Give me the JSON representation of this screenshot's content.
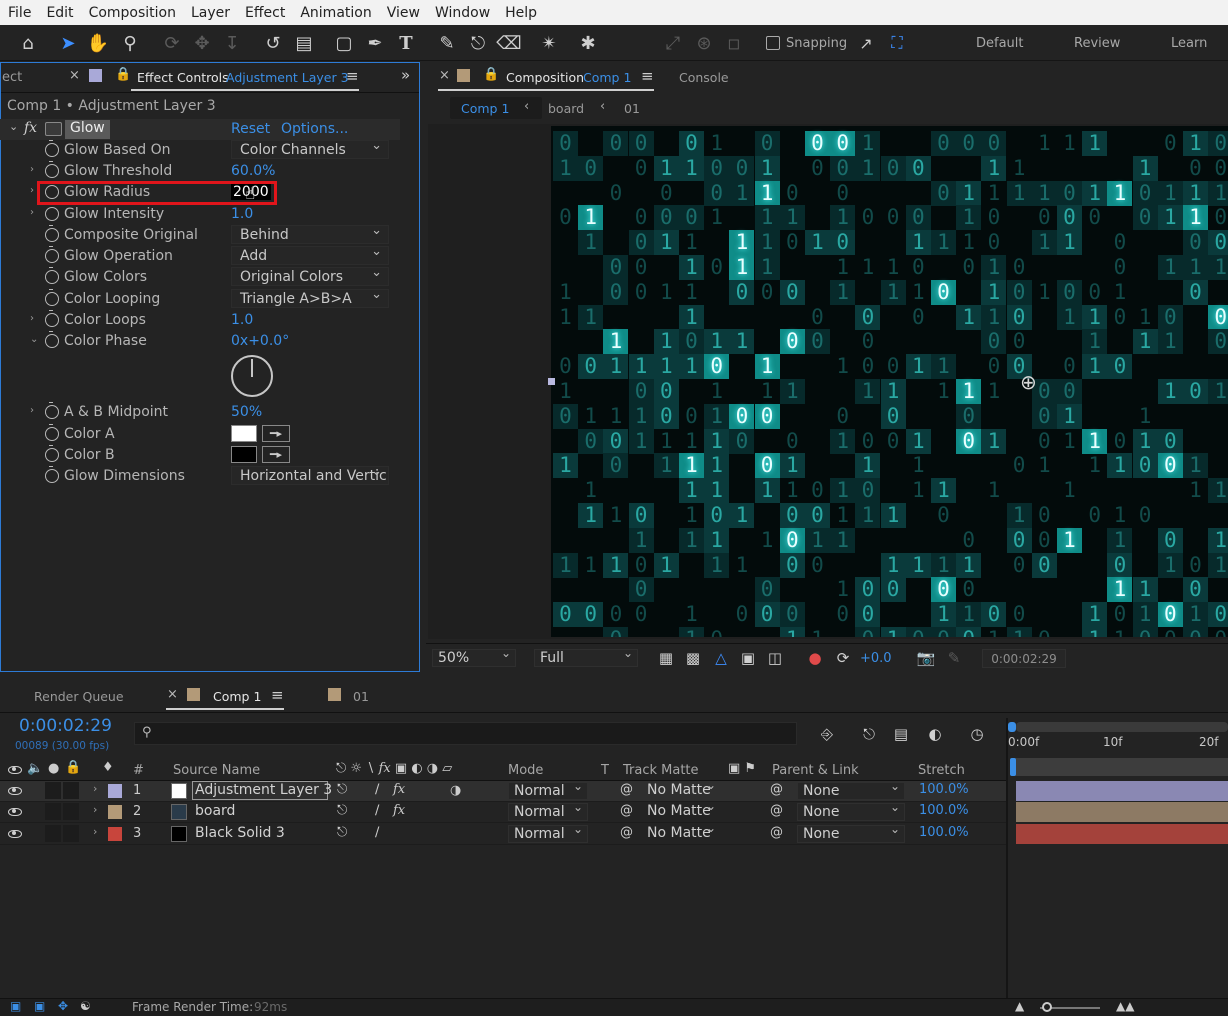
{
  "menu": [
    "File",
    "Edit",
    "Composition",
    "Layer",
    "Effect",
    "Animation",
    "View",
    "Window",
    "Help"
  ],
  "toolbar": {
    "snapping_label": "Snapping",
    "workspaces": [
      "Default",
      "Review",
      "Learn"
    ]
  },
  "effect_controls": {
    "prev_tab_fragment": "ect",
    "tab_title": "Effect Controls",
    "tab_layer": "Adjustment Layer 3",
    "breadcrumb": "Comp 1 • Adjustment Layer 3",
    "effect_name": "Glow",
    "reset_label": "Reset",
    "options_label": "Options...",
    "properties": [
      {
        "name": "Glow Based On",
        "value": "Color Channels",
        "kind": "dropdown"
      },
      {
        "name": "Glow Threshold",
        "value": "60.0%",
        "kind": "number"
      },
      {
        "name": "Glow Radius",
        "value": "2000",
        "kind": "editing"
      },
      {
        "name": "Glow Intensity",
        "value": "1.0",
        "kind": "number"
      },
      {
        "name": "Composite Original",
        "value": "Behind",
        "kind": "dropdown"
      },
      {
        "name": "Glow Operation",
        "value": "Add",
        "kind": "dropdown"
      },
      {
        "name": "Glow Colors",
        "value": "Original Colors",
        "kind": "dropdown"
      },
      {
        "name": "Color Looping",
        "value": "Triangle A>B>A",
        "kind": "dropdown"
      },
      {
        "name": "Color Loops",
        "value": "1.0",
        "kind": "number"
      },
      {
        "name": "Color Phase",
        "value": "0x+0.0°",
        "kind": "number"
      },
      {
        "name": "A & B Midpoint",
        "value": "50%",
        "kind": "number"
      },
      {
        "name": "Color A",
        "value": "#ffffff",
        "kind": "color"
      },
      {
        "name": "Color B",
        "value": "#000000",
        "kind": "color"
      },
      {
        "name": "Glow Dimensions",
        "value": "Horizontal and Vertic",
        "kind": "dropdown"
      }
    ]
  },
  "composition": {
    "tab_title": "Composition",
    "tab_comp": "Comp 1",
    "console_tab": "Console",
    "crumbs": [
      "Comp 1",
      "board",
      "01"
    ],
    "zoom": "50%",
    "resolution": "Full",
    "exposure": "+0.0",
    "timecode": "0:00:02:29"
  },
  "timeline": {
    "render_queue_tab": "Render Queue",
    "comp_tab": "Comp 1",
    "other_tab": "01",
    "timecode": "0:00:02:29",
    "frame_info": "00089 (30.00 fps)",
    "search_placeholder": "",
    "columns": {
      "num": "#",
      "source": "Source Name",
      "mode": "Mode",
      "t": "T",
      "track_matte": "Track Matte",
      "parent": "Parent & Link",
      "stretch": "Stretch"
    },
    "ruler": [
      "0:00f",
      "10f",
      "20f"
    ],
    "layers": [
      {
        "index": "1",
        "name": "Adjustment Layer 3",
        "label_color": "#a9a9d8",
        "swatch": "#ffffff",
        "mode": "Normal",
        "matte": "No Matte",
        "parent": "None",
        "stretch": "100.0%",
        "bar_color": "#8a88b3",
        "fx": true
      },
      {
        "index": "2",
        "name": "board",
        "label_color": "#b39a78",
        "swatch": "#2a3b4a",
        "mode": "Normal",
        "matte": "No Matte",
        "parent": "None",
        "stretch": "100.0%",
        "bar_color": "#8d7a64",
        "fx": true
      },
      {
        "index": "3",
        "name": "Black Solid 3",
        "label_color": "#c8453c",
        "swatch": "#000000",
        "mode": "Normal",
        "matte": "No Matte",
        "parent": "None",
        "stretch": "100.0%",
        "bar_color": "#a4423b",
        "fx": false
      }
    ]
  },
  "status": {
    "label": "Frame Render Time:",
    "value": "92ms"
  },
  "colors": {
    "accent": "#2d7bd6",
    "value_blue": "#3b8fe6",
    "highlight_red": "#e0151b",
    "matrix_teal": "#1fd6cf"
  }
}
